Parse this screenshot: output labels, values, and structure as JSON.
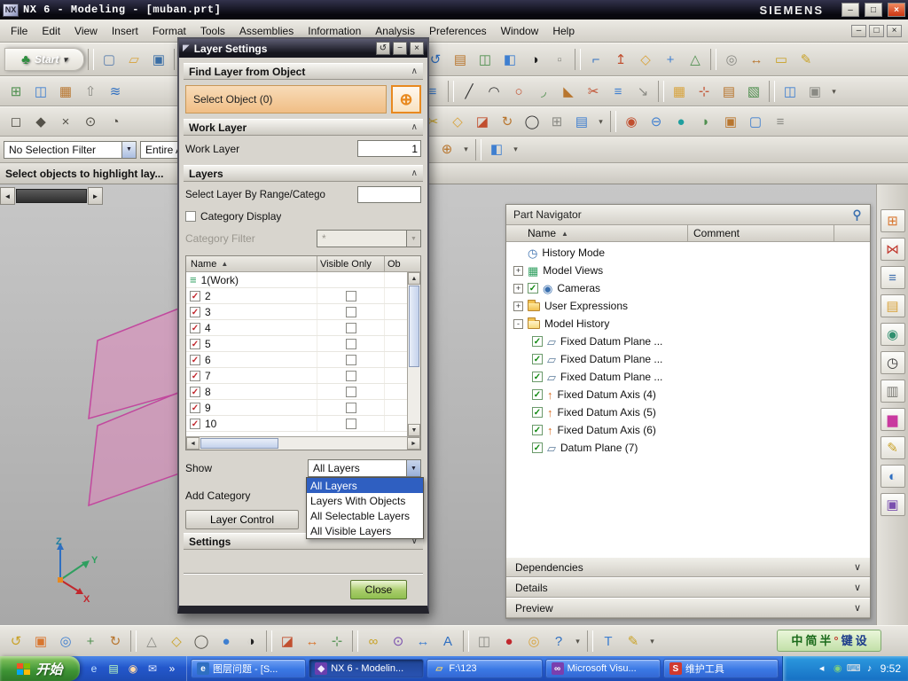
{
  "titlebar": {
    "title": "NX 6 - Modeling - [muban.prt]",
    "brand": "SIEMENS"
  },
  "menubar": {
    "items": [
      "File",
      "Edit",
      "View",
      "Insert",
      "Format",
      "Tools",
      "Assemblies",
      "Information",
      "Analysis",
      "Preferences",
      "Window",
      "Help"
    ]
  },
  "selection_bar": {
    "filter": "No Selection Filter",
    "scope": "Entire A"
  },
  "prompt": "Select objects to highlight lay...",
  "graphics": {
    "triad": {
      "x": "X",
      "y": "Y",
      "z": "Z"
    }
  },
  "toolbars": {
    "row1": [
      {
        "n": "start-menu",
        "label": "Start",
        "g": "♣",
        "c": "#2f8f3f",
        "cls": "start",
        "arrow": true
      },
      {
        "sep": true
      },
      {
        "n": "new-file",
        "g": "▢",
        "c": "#5b7fae"
      },
      {
        "n": "open-file",
        "g": "▱",
        "c": "#d8a33c"
      },
      {
        "n": "save-file",
        "g": "▣",
        "c": "#3a6ea5"
      },
      {
        "sep": true
      },
      {
        "n": "cut",
        "g": "✂",
        "c": "#9a9a94"
      },
      {
        "n": "copy",
        "g": "◫",
        "c": "#9a9a94"
      },
      {
        "n": "paste",
        "g": "⊡",
        "c": "#9a9a94"
      },
      {
        "sep": true
      },
      {
        "n": "delete",
        "g": "×",
        "c": "#9a9a94"
      },
      {
        "n": "undo",
        "g": "↶",
        "c": "#9a9a94"
      },
      {
        "gap": 118
      },
      {
        "n": "refresh-view",
        "g": "↺",
        "c": "#2f6fc1"
      },
      {
        "n": "snapshot",
        "g": "▤",
        "c": "#b8762f"
      },
      {
        "n": "visualization",
        "g": "◫",
        "c": "#4f8f4f"
      },
      {
        "n": "shaded-view",
        "g": "◧",
        "c": "#3f7fd0"
      },
      {
        "n": "true-shading",
        "g": "◑",
        "c": "#222222"
      },
      {
        "n": "export-part",
        "g": "▫",
        "c": "#8a8a84"
      },
      {
        "sep": true
      },
      {
        "n": "sketch",
        "g": "⌐",
        "c": "#2f6fc1"
      },
      {
        "n": "datum-axis",
        "g": "↥",
        "c": "#c14f2f"
      },
      {
        "n": "datum-plane",
        "g": "◇",
        "c": "#d8a33c"
      },
      {
        "n": "point",
        "g": "+",
        "c": "#3f7fd0"
      },
      {
        "n": "orient-view",
        "g": "△",
        "c": "#4f8f4f"
      },
      {
        "sep": true
      },
      {
        "n": "sphere-point",
        "g": "◎",
        "c": "#8a8a84"
      },
      {
        "n": "measure-distance",
        "g": "↔",
        "c": "#b8762f"
      },
      {
        "n": "ruler",
        "g": "▭",
        "c": "#c9a227"
      },
      {
        "n": "annotation-edit",
        "g": "✎",
        "c": "#c9a227"
      }
    ],
    "row2": [
      {
        "n": "pattern-face",
        "g": "⊞",
        "c": "#4f8f4f"
      },
      {
        "n": "mirror-body",
        "g": "◫",
        "c": "#3f7fd0"
      },
      {
        "n": "instance-geometry",
        "g": "▦",
        "c": "#b8762f"
      },
      {
        "n": "promote-body",
        "g": "⇧",
        "c": "#8a8a84"
      },
      {
        "n": "synchronous-modeling",
        "g": "≋",
        "c": "#2f6fc1"
      },
      {
        "gap": 330
      },
      {
        "n": "view-overlay",
        "g": "≡",
        "c": "#3f7fd0"
      },
      {
        "sep": true
      },
      {
        "n": "line",
        "g": "╱",
        "c": "#333333"
      },
      {
        "n": "arc",
        "g": "◠",
        "c": "#333333"
      },
      {
        "n": "circle",
        "g": "○",
        "c": "#c14f2f"
      },
      {
        "n": "fillet",
        "g": "◞",
        "c": "#4f8f4f"
      },
      {
        "n": "chamfer",
        "g": "◣",
        "c": "#b8762f"
      },
      {
        "n": "trim-curve",
        "g": "✂",
        "c": "#c14f2f"
      },
      {
        "n": "offset-curve",
        "g": "≡",
        "c": "#3f7fd0"
      },
      {
        "n": "project-curve",
        "g": "↘",
        "c": "#8a8a84"
      },
      {
        "sep": true
      },
      {
        "n": "datum-grid",
        "g": "▦",
        "c": "#d8a33c"
      },
      {
        "n": "datum-csys",
        "g": "⊹",
        "c": "#c14f2f"
      },
      {
        "n": "plane-set",
        "g": "▤",
        "c": "#b8762f"
      },
      {
        "n": "face-analysis",
        "g": "▧",
        "c": "#4f8f4f"
      },
      {
        "sep": true
      },
      {
        "n": "window-split",
        "g": "◫",
        "c": "#3f7fd0"
      },
      {
        "n": "window-new",
        "g": "▣",
        "c": "#8a8a84"
      },
      {
        "n": "row2-more",
        "g": "▾",
        "cls": "mini"
      }
    ],
    "row3": [
      {
        "n": "snap-endpoint",
        "g": "◻",
        "c": "#55524a"
      },
      {
        "n": "snap-midpoint",
        "g": "◆",
        "c": "#55524a"
      },
      {
        "n": "snap-intersection",
        "g": "×",
        "c": "#55524a"
      },
      {
        "n": "snap-center",
        "g": "⊙",
        "c": "#55524a"
      },
      {
        "n": "snap-quadrant",
        "g": "◔",
        "c": "#55524a"
      },
      {
        "gap": 330
      },
      {
        "n": "edit-section",
        "g": "✂",
        "c": "#c9a227"
      },
      {
        "n": "datum-plane-small",
        "g": "◇",
        "c": "#d8a33c"
      },
      {
        "n": "extrude",
        "g": "◪",
        "c": "#c14f2f"
      },
      {
        "n": "revolve",
        "g": "↻",
        "c": "#b8762f"
      },
      {
        "n": "hole",
        "g": "◯",
        "c": "#333333"
      },
      {
        "n": "grid-table",
        "g": "⊞",
        "c": "#8a8a84"
      },
      {
        "n": "view-section",
        "g": "▤",
        "c": "#3f7fd0"
      },
      {
        "n": "row3-more",
        "g": "▾",
        "cls": "mini"
      },
      {
        "sep": true
      },
      {
        "n": "unite",
        "g": "◉",
        "c": "#c14f2f"
      },
      {
        "n": "subtract",
        "g": "⊖",
        "c": "#3f7fd0"
      },
      {
        "n": "sphere-primitive",
        "g": "●",
        "c": "#1f9f9f"
      },
      {
        "n": "edge-blend",
        "g": "◗",
        "c": "#4f8f4f"
      },
      {
        "n": "pocket",
        "g": "▣",
        "c": "#b8762f"
      },
      {
        "n": "shell",
        "g": "▢",
        "c": "#3f7fd0"
      },
      {
        "n": "feature-list",
        "g": "≡",
        "c": "#8a8a84"
      }
    ],
    "selection_row": [
      {
        "n": "snap-point",
        "g": "⊕",
        "c": "#b8762f"
      },
      {
        "n": "snap-more",
        "g": "▾",
        "cls": "mini"
      },
      {
        "sep": true
      },
      {
        "n": "work-part",
        "g": "◧",
        "c": "#3f7fd0"
      },
      {
        "n": "part-more",
        "g": "▾",
        "cls": "mini"
      }
    ],
    "bottom": [
      {
        "n": "view-refresh",
        "g": "↺",
        "c": "#c9a227"
      },
      {
        "n": "fit-view",
        "g": "▣",
        "c": "#d8762f"
      },
      {
        "n": "zoom-view",
        "g": "◎",
        "c": "#3f7fd0"
      },
      {
        "n": "pan-view",
        "g": "+",
        "c": "#4f8f4f"
      },
      {
        "n": "rotate-view",
        "g": "↻",
        "c": "#b8762f"
      },
      {
        "sep": true
      },
      {
        "n": "perspective-view",
        "g": "△",
        "c": "#8a8a84"
      },
      {
        "n": "snap-view",
        "g": "◇",
        "c": "#c9a227"
      },
      {
        "n": "wireframe-display",
        "g": "◯",
        "c": "#55524a"
      },
      {
        "n": "shaded-display",
        "g": "●",
        "c": "#3f7fd0"
      },
      {
        "n": "studio-display",
        "g": "◑",
        "c": "#222222"
      },
      {
        "sep": true
      },
      {
        "n": "clip-section",
        "g": "◪",
        "c": "#c14f2f"
      },
      {
        "n": "move-object",
        "g": "↔",
        "c": "#d8762f"
      },
      {
        "n": "align-object",
        "g": "⊹",
        "c": "#4f8f4f"
      },
      {
        "sep": true
      },
      {
        "n": "chain-link",
        "g": "∞",
        "c": "#c9a227"
      },
      {
        "n": "constraints",
        "g": "⊙",
        "c": "#7a4fae"
      },
      {
        "n": "dimension",
        "g": "↔",
        "c": "#3f7fd0"
      },
      {
        "n": "note-text",
        "g": "A",
        "c": "#2f6fc1"
      },
      {
        "sep": true
      },
      {
        "n": "window-tile",
        "g": "◫",
        "c": "#8a8a84"
      },
      {
        "n": "macro-record",
        "g": "●",
        "c": "#c1272d"
      },
      {
        "n": "command-finder",
        "g": "◎",
        "c": "#d8a33c"
      },
      {
        "n": "context-help",
        "g": "?",
        "c": "#2f6fc1"
      },
      {
        "n": "bottom-more1",
        "g": "▾",
        "cls": "mini"
      },
      {
        "sep": true
      },
      {
        "n": "text-tool",
        "g": "T",
        "c": "#3f7fd0"
      },
      {
        "n": "pencil-tool",
        "g": "✎",
        "c": "#c9a227"
      },
      {
        "n": "bottom-more2",
        "g": "▾",
        "cls": "mini"
      }
    ],
    "right": [
      {
        "n": "assembly-navigator",
        "g": "⊞",
        "c": "#d8762f"
      },
      {
        "n": "constraint-navigator",
        "g": "⋈",
        "c": "#c13a2f"
      },
      {
        "n": "part-navigator",
        "g": "≡",
        "c": "#3f6fae"
      },
      {
        "n": "reuse-library",
        "g": "▤",
        "c": "#d8a33c"
      },
      {
        "n": "hd3d-tools",
        "g": "◉",
        "c": "#2f8f6f"
      },
      {
        "n": "history-palette",
        "g": "◷",
        "c": "#333333"
      },
      {
        "n": "system-materials",
        "g": "▥",
        "c": "#7a7a74"
      },
      {
        "n": "color-palette",
        "g": "▆",
        "c": "#c9399f"
      },
      {
        "n": "pencil-sketcher",
        "g": "✎",
        "c": "#c9a227"
      },
      {
        "n": "web-browser",
        "g": "◐",
        "c": "#2f6fc1"
      },
      {
        "n": "touch-panel",
        "g": "▣",
        "c": "#7a4fae"
      }
    ]
  },
  "dialog": {
    "title": "Layer Settings",
    "find_layer": {
      "header": "Find Layer from Object",
      "select_object": "Select Object (0)"
    },
    "work_layer": {
      "header": "Work Layer",
      "label": "Work Layer",
      "value": "1"
    },
    "layers": {
      "header": "Layers",
      "range_label": "Select Layer By Range/Catego",
      "category_display": "Category Display",
      "category_filter_label": "Category Filter",
      "category_filter_value": "*",
      "table": {
        "col_name": "Name",
        "col_visible": "Visible Only",
        "col_other": "Ob",
        "rows": [
          {
            "name": "1(Work)",
            "work": true
          },
          {
            "name": "2"
          },
          {
            "name": "3"
          },
          {
            "name": "4"
          },
          {
            "name": "5"
          },
          {
            "name": "6"
          },
          {
            "name": "7"
          },
          {
            "name": "8"
          },
          {
            "name": "9"
          },
          {
            "name": "10"
          }
        ]
      },
      "show_label": "Show",
      "show_value": "All Layers",
      "show_options": [
        "All Layers",
        "Layers With Objects",
        "All Selectable Layers",
        "All Visible Layers"
      ],
      "add_category_label": "Add Category",
      "layer_control_button": "Layer Control"
    },
    "settings_header": "Settings",
    "close_button": "Close"
  },
  "part_navigator": {
    "title": "Part Navigator",
    "columns": {
      "name": "Name",
      "comment": "Comment"
    },
    "tree": [
      {
        "type": "clock",
        "label": "History Mode"
      },
      {
        "expand": "+",
        "type": "grid",
        "label": "Model Views"
      },
      {
        "expand": "+",
        "type": "camera",
        "check": true,
        "label": "Cameras"
      },
      {
        "expand": "+",
        "type": "folder",
        "label": "User Expressions"
      },
      {
        "expand": "-",
        "type": "folder-open",
        "label": "Model History"
      },
      {
        "child": true,
        "check": true,
        "type": "plane",
        "label": "Fixed Datum Plane ..."
      },
      {
        "child": true,
        "check": true,
        "type": "plane",
        "label": "Fixed Datum Plane ..."
      },
      {
        "child": true,
        "check": true,
        "type": "plane",
        "label": "Fixed Datum Plane ..."
      },
      {
        "child": true,
        "check": true,
        "type": "axis",
        "label": "Fixed Datum Axis (4)"
      },
      {
        "child": true,
        "check": true,
        "type": "axis",
        "label": "Fixed Datum Axis (5)"
      },
      {
        "child": true,
        "check": true,
        "type": "axis",
        "label": "Fixed Datum Axis (6)"
      },
      {
        "child": true,
        "check": true,
        "type": "plane",
        "label": "Datum Plane (7)"
      }
    ],
    "panels": [
      "Dependencies",
      "Details",
      "Preview"
    ]
  },
  "taskbar": {
    "start_label": "开始",
    "quick_launch": [
      {
        "n": "ql-internet-explorer",
        "g": "e",
        "c": "#bfe0ff"
      },
      {
        "n": "ql-show-desktop",
        "g": "▤",
        "c": "#bfffbf"
      },
      {
        "n": "ql-media-player",
        "g": "◉",
        "c": "#ffd9a8"
      },
      {
        "n": "ql-mail",
        "g": "✉",
        "c": "#dfe8ff"
      },
      {
        "n": "ql-more",
        "g": "»",
        "c": "#ffffff"
      }
    ],
    "tasks": [
      {
        "n": "task-ie-layer-question",
        "g": "e",
        "c": "#ffffff",
        "bgc": "#2f6fc1",
        "label": "图层问题 - [S..."
      },
      {
        "n": "task-nx",
        "g": "◆",
        "c": "#f0e8ff",
        "bgc": "#6a3fae",
        "label": "NX 6 - Modelin...",
        "active": true
      },
      {
        "n": "task-explorer-f123",
        "g": "▱",
        "c": "#ffd96a",
        "label": "F:\\123"
      },
      {
        "n": "task-visual-studio",
        "g": "∞",
        "c": "#ffffff",
        "bgc": "#7a3fae",
        "label": "Microsoft Visu..."
      },
      {
        "n": "task-s-tool",
        "g": "S",
        "c": "#ffffff",
        "bgc": "#d03a2f",
        "label": "维护工具"
      }
    ],
    "ime": {
      "items": [
        {
          "t": "中",
          "c": "#1a6a1a"
        },
        {
          "t": "简",
          "c": "#1a6a1a"
        },
        {
          "t": "半",
          "c": "#1a6a1a"
        },
        {
          "t": "°",
          "c": "#c13a2f"
        },
        {
          "t": "键",
          "c": "#1a3a8a"
        },
        {
          "t": "设",
          "c": "#1a3a8a"
        }
      ]
    },
    "tray": {
      "icons": [
        {
          "n": "tray-expand",
          "g": "◂",
          "c": "#ffffff"
        },
        {
          "n": "tray-safety",
          "g": "◉",
          "c": "#7fd07f"
        },
        {
          "n": "tray-ime",
          "g": "⌨",
          "c": "#e8e8e8"
        },
        {
          "n": "tray-volume",
          "g": "♪",
          "c": "#ffffff"
        }
      ],
      "time": "9:52"
    }
  }
}
